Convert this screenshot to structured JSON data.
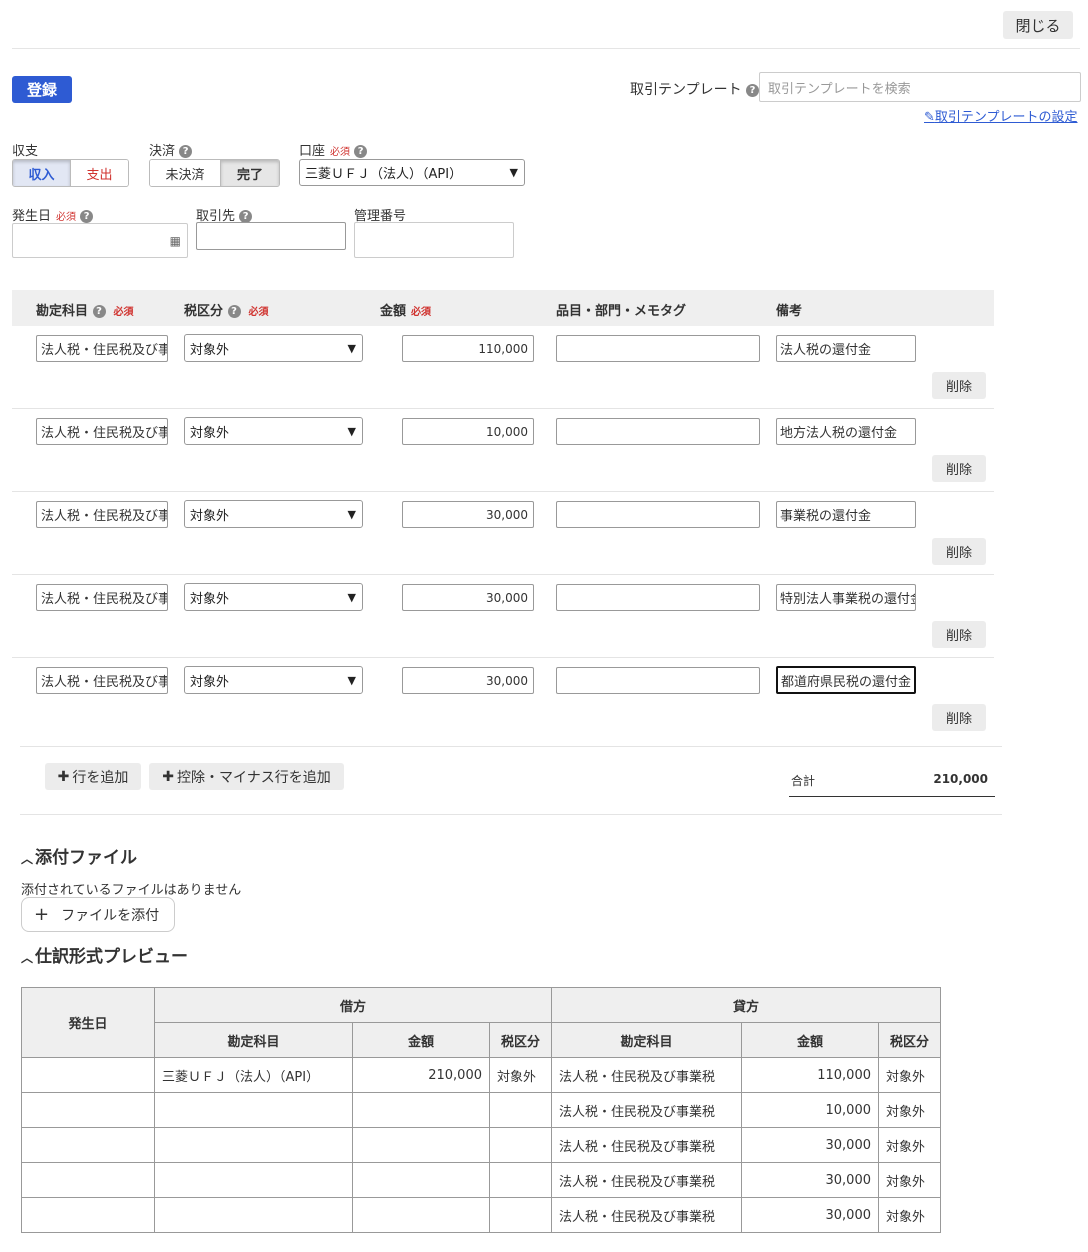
{
  "header": {
    "close_label": "閉じる",
    "register_label": "登録",
    "template_label": "取引テンプレート",
    "template_placeholder": "取引テンプレートを検索",
    "template_settings_link": "取引テンプレートの設定"
  },
  "form": {
    "required_label": "必須",
    "income_expense": {
      "label": "収支",
      "options": [
        "収入",
        "支出"
      ],
      "selected": "収入"
    },
    "settlement": {
      "label": "決済",
      "options": [
        "未決済",
        "完了"
      ],
      "selected": "完了"
    },
    "account": {
      "label": "口座",
      "value": "三菱ＵＦＪ（法人）（API）"
    },
    "date": {
      "label": "発生日",
      "value": ""
    },
    "partner": {
      "label": "取引先",
      "value": ""
    },
    "ref_number": {
      "label": "管理番号",
      "value": ""
    }
  },
  "grid": {
    "headers": {
      "account_item": "勘定科目",
      "tax": "税区分",
      "amount": "金額",
      "tags": "品目・部門・メモタグ",
      "note": "備考"
    },
    "delete_label": "削除",
    "rows": [
      {
        "account_item": "法人税・住民税及び事業税",
        "tax": "対象外",
        "amount": "110,000",
        "tags": "",
        "note": "法人税の還付金"
      },
      {
        "account_item": "法人税・住民税及び事業税",
        "tax": "対象外",
        "amount": "10,000",
        "tags": "",
        "note": "地方法人税の還付金"
      },
      {
        "account_item": "法人税・住民税及び事業税",
        "tax": "対象外",
        "amount": "30,000",
        "tags": "",
        "note": "事業税の還付金"
      },
      {
        "account_item": "法人税・住民税及び事業税",
        "tax": "対象外",
        "amount": "30,000",
        "tags": "",
        "note": "特別法人事業税の還付金"
      },
      {
        "account_item": "法人税・住民税及び事業税",
        "tax": "対象外",
        "amount": "30,000",
        "tags": "",
        "note": "都道府県民税の還付金"
      }
    ],
    "add_row_label": "行を追加",
    "add_minus_row_label": "控除・マイナス行を追加",
    "total_label": "合計",
    "total_value": "210,000"
  },
  "attachments": {
    "title": "添付ファイル",
    "empty_text": "添付されているファイルはありません",
    "add_label": "ファイルを添付"
  },
  "preview": {
    "title": "仕訳形式プレビュー",
    "date_header": "発生日",
    "debit_header": "借方",
    "credit_header": "貸方",
    "sub_headers": {
      "account": "勘定科目",
      "amount": "金額",
      "tax": "税区分"
    },
    "rows": [
      {
        "date": "",
        "debit_account": "三菱ＵＦＪ（法人）（API）",
        "debit_amount": "210,000",
        "debit_tax": "対象外",
        "credit_account": "法人税・住民税及び事業税",
        "credit_amount": "110,000",
        "credit_tax": "対象外"
      },
      {
        "date": "",
        "debit_account": "",
        "debit_amount": "",
        "debit_tax": "",
        "credit_account": "法人税・住民税及び事業税",
        "credit_amount": "10,000",
        "credit_tax": "対象外"
      },
      {
        "date": "",
        "debit_account": "",
        "debit_amount": "",
        "debit_tax": "",
        "credit_account": "法人税・住民税及び事業税",
        "credit_amount": "30,000",
        "credit_tax": "対象外"
      },
      {
        "date": "",
        "debit_account": "",
        "debit_amount": "",
        "debit_tax": "",
        "credit_account": "法人税・住民税及び事業税",
        "credit_amount": "30,000",
        "credit_tax": "対象外"
      },
      {
        "date": "",
        "debit_account": "",
        "debit_amount": "",
        "debit_tax": "",
        "credit_account": "法人税・住民税及び事業税",
        "credit_amount": "30,000",
        "credit_tax": "対象外"
      }
    ]
  },
  "colors": {
    "primary": "#2e5bd3",
    "required": "#d0332f",
    "button_gray": "#ececec"
  }
}
